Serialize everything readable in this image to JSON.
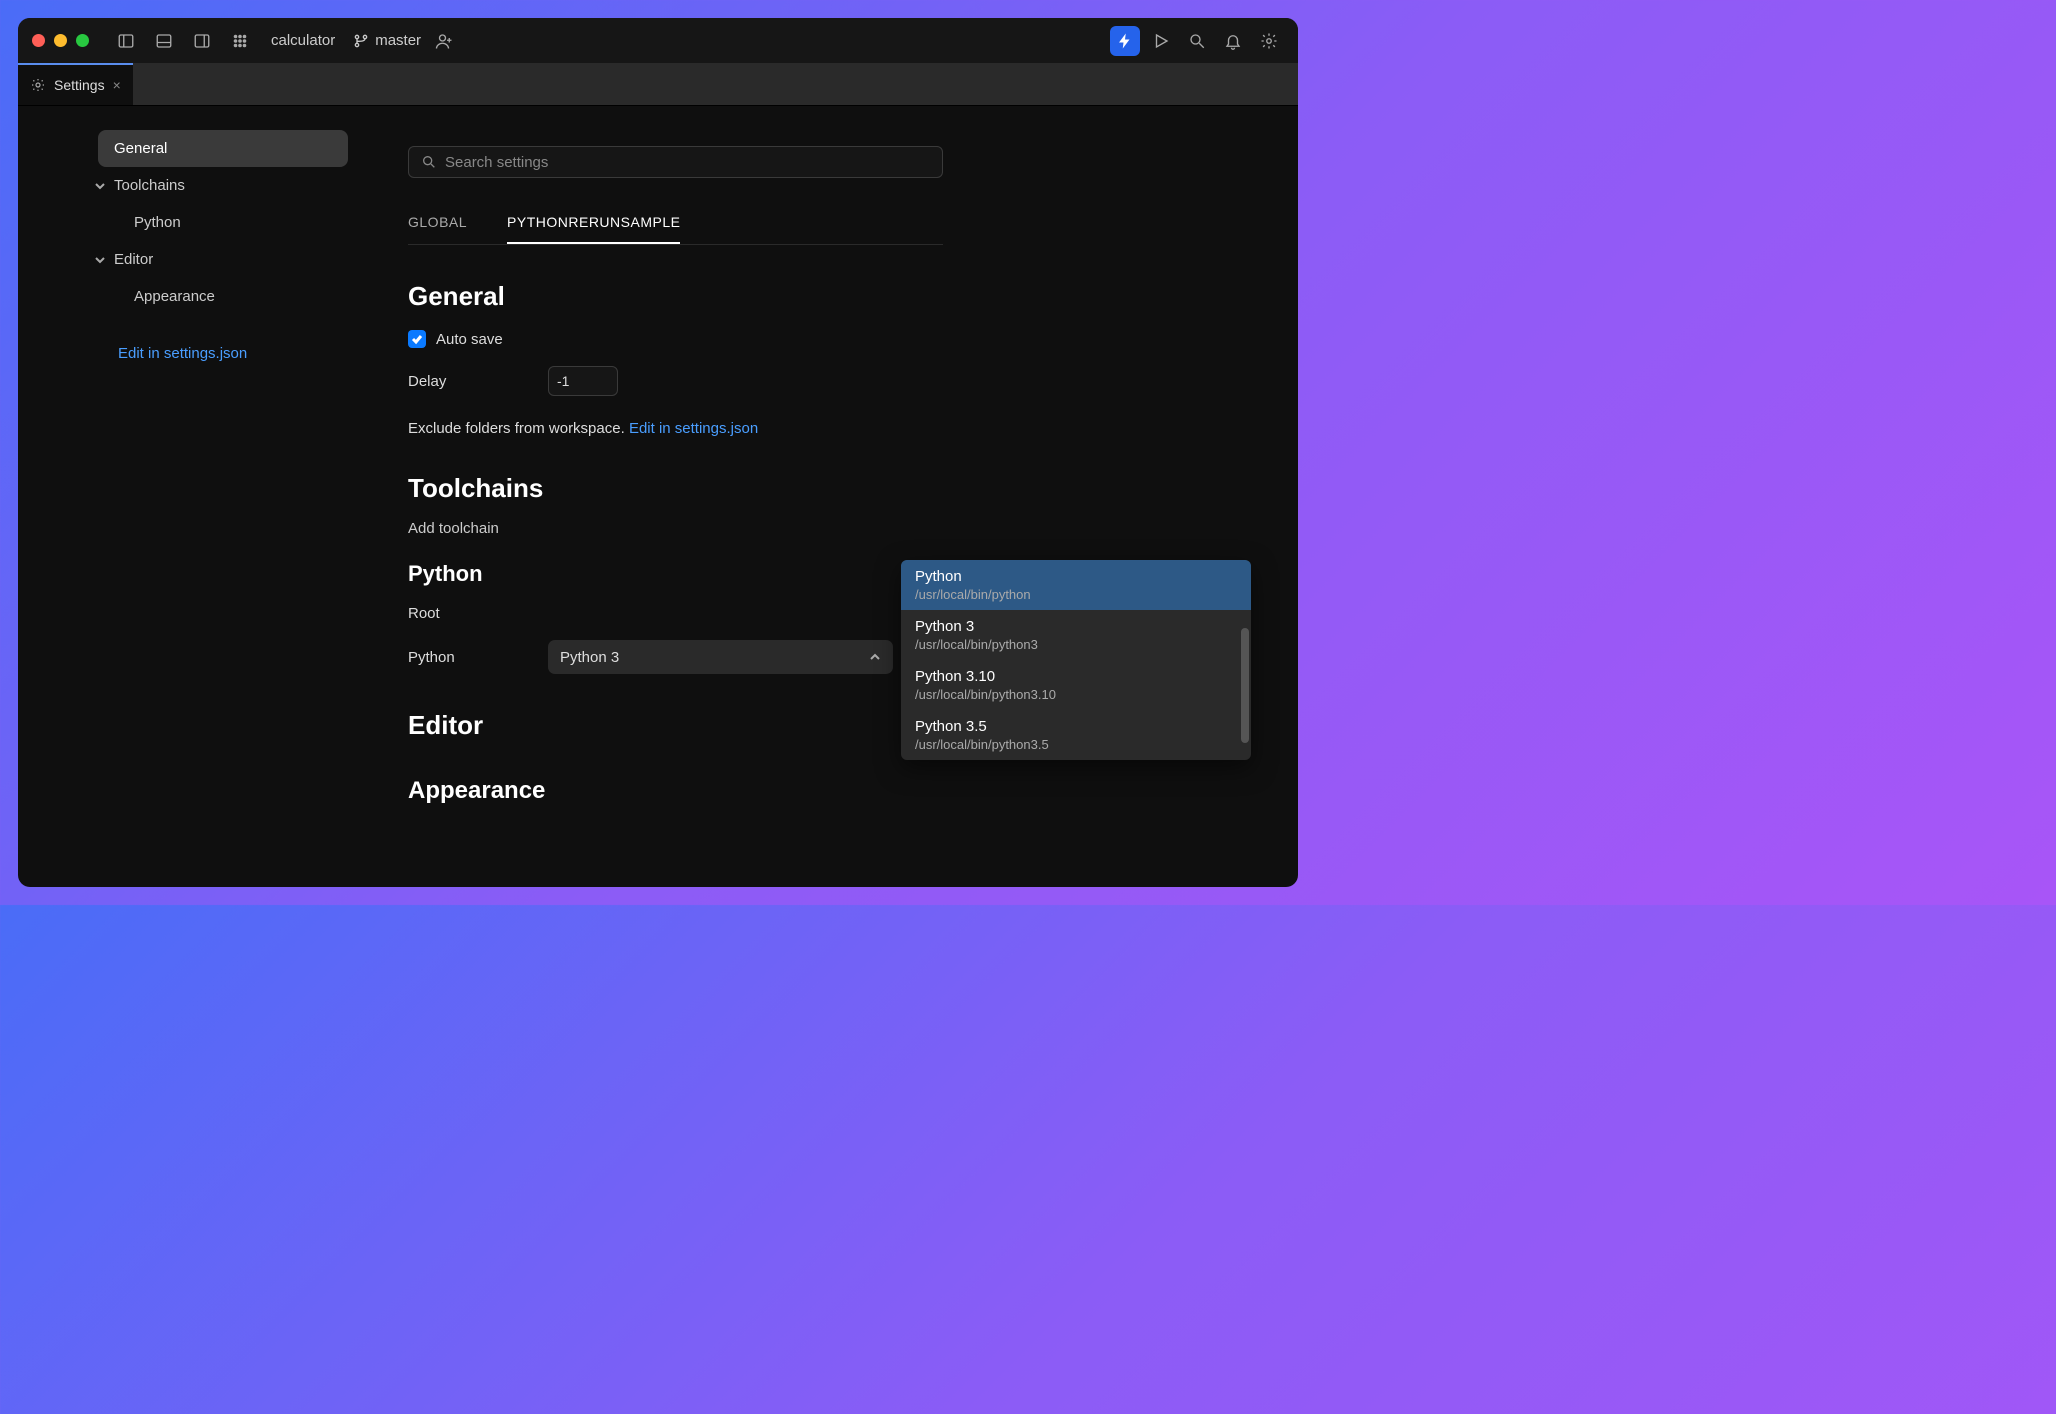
{
  "project": "calculator",
  "branch": "master",
  "tab": {
    "label": "Settings"
  },
  "search": {
    "placeholder": "Search settings"
  },
  "sidebar": {
    "items": [
      {
        "label": "General"
      },
      {
        "label": "Toolchains"
      },
      {
        "label": "Python"
      },
      {
        "label": "Editor"
      },
      {
        "label": "Appearance"
      }
    ],
    "edit_link": "Edit in settings.json"
  },
  "scope_tabs": {
    "global": "GLOBAL",
    "project": "PYTHONRERUNSAMPLE"
  },
  "sections": {
    "general": {
      "title": "General",
      "auto_save": "Auto save",
      "delay_label": "Delay",
      "delay_value": "-1",
      "exclude_text": "Exclude folders from workspace.",
      "exclude_link": "Edit in settings.json"
    },
    "toolchains": {
      "title": "Toolchains",
      "add": "Add toolchain",
      "python_title": "Python",
      "root_label": "Root",
      "python_label": "Python",
      "python_value": "Python 3"
    },
    "editor": {
      "title": "Editor",
      "appearance_title": "Appearance"
    }
  },
  "dropdown": {
    "items": [
      {
        "name": "Python",
        "path": "/usr/local/bin/python"
      },
      {
        "name": "Python 3",
        "path": "/usr/local/bin/python3"
      },
      {
        "name": "Python 3.10",
        "path": "/usr/local/bin/python3.10"
      },
      {
        "name": "Python 3.5",
        "path": "/usr/local/bin/python3.5"
      }
    ]
  }
}
